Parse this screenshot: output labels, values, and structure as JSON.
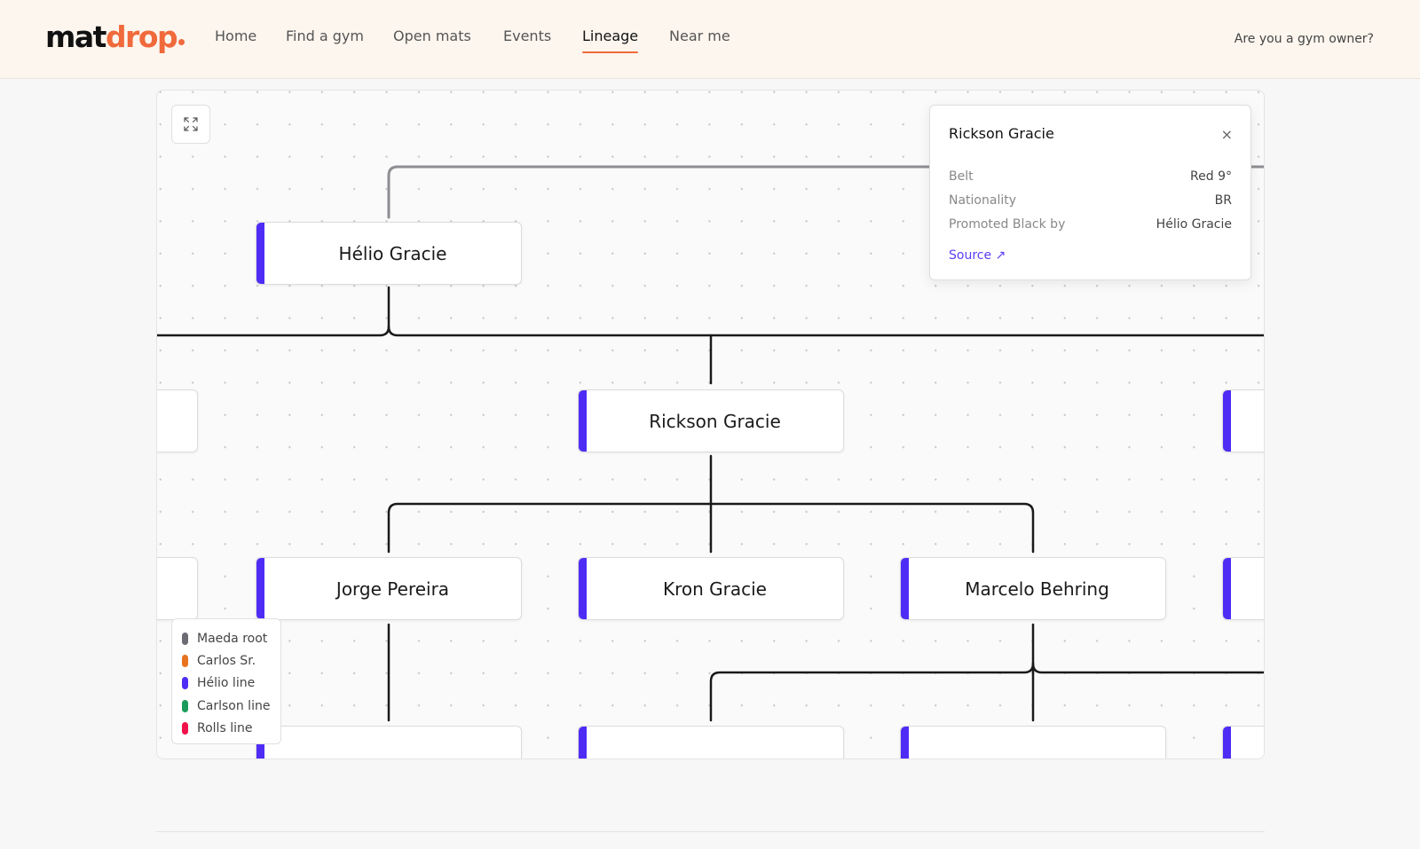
{
  "header": {
    "logo_part1": "mat",
    "logo_part2": "drop",
    "nav": [
      {
        "label": "Home"
      },
      {
        "label": "Find a gym"
      },
      {
        "label": "Open mats"
      },
      {
        "label": "Events"
      },
      {
        "label": "Lineage",
        "active": true
      },
      {
        "label": "Near me"
      }
    ],
    "owner_link": "Are you a gym owner?"
  },
  "tree": {
    "nodes": {
      "helio": "Hélio Gracie",
      "rickson": "Rickson Gracie",
      "jorge": "Jorge Pereira",
      "kron": "Kron Gracie",
      "marcelo": "Marcelo Behring"
    },
    "accent_color": "#4f2cf5"
  },
  "legend": [
    {
      "label": "Maeda root",
      "color": "#6b6b73"
    },
    {
      "label": "Carlos Sr.",
      "color": "#e8731e"
    },
    {
      "label": "Hélio line",
      "color": "#4f2cf5"
    },
    {
      "label": "Carlson line",
      "color": "#1a9b5c"
    },
    {
      "label": "Rolls line",
      "color": "#f0124a"
    }
  ],
  "popover": {
    "title": "Rickson Gracie",
    "close": "×",
    "rows": [
      {
        "key": "Belt",
        "value": "Red 9°"
      },
      {
        "key": "Nationality",
        "value": "BR"
      },
      {
        "key": "Promoted Black by",
        "value": "Hélio Gracie"
      }
    ],
    "source_label": "Source ↗"
  }
}
